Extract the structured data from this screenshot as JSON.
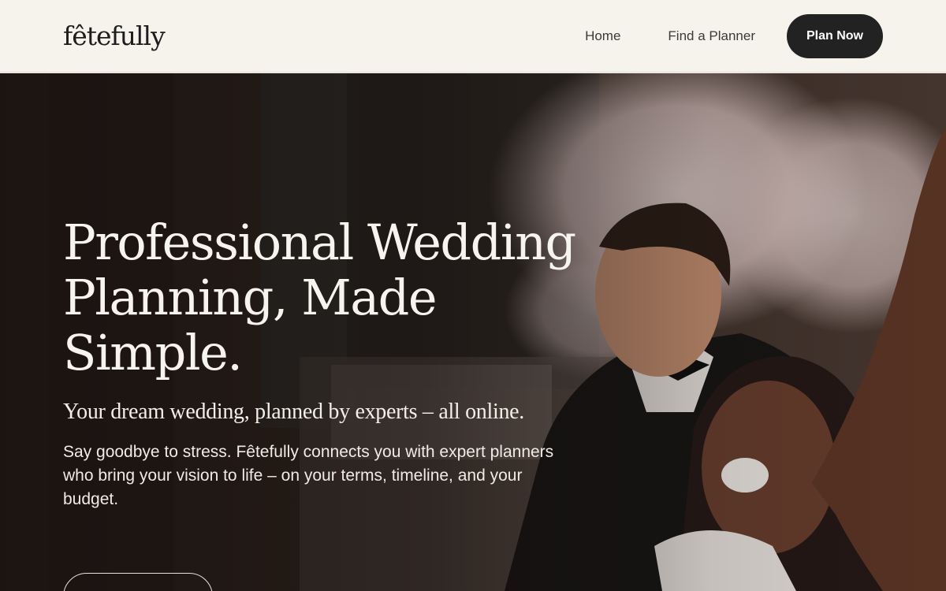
{
  "header": {
    "logo": "fêtefully",
    "nav": {
      "home": "Home",
      "find_planner": "Find a Planner",
      "cta": "Plan Now"
    }
  },
  "hero": {
    "title_line1": "Professional Wedding",
    "title_line2": "Planning, Made",
    "title_line3": "Simple.",
    "subtitle": "Your dream wedding, planned by experts – all online.",
    "body_line1": "Say goodbye to stress. Fêtefully connects you with expert planners",
    "body_line2": "who bring your vision to life – on your terms, timeline, and your",
    "body_line3": "budget."
  },
  "colors": {
    "background": "#f6f2ec",
    "cta_bg": "#222222",
    "hero_text": "#f7f3ee"
  }
}
